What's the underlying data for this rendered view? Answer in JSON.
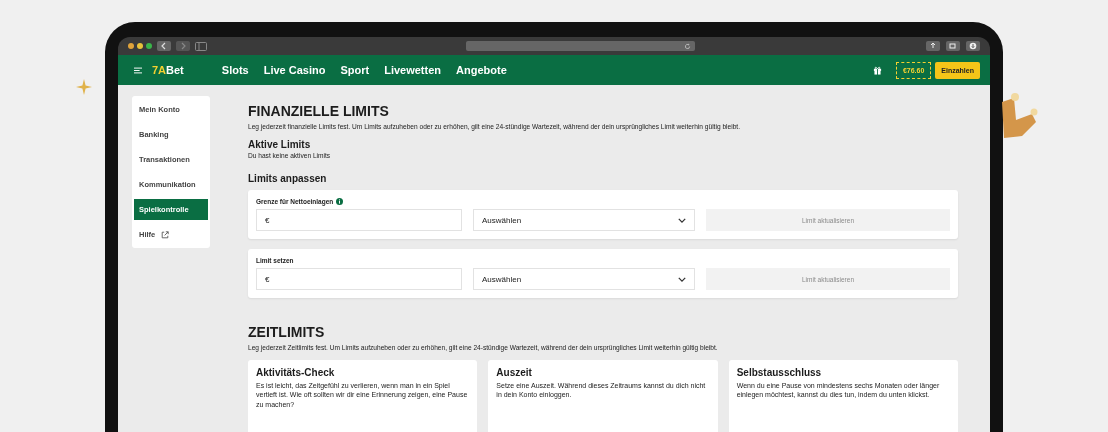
{
  "nav": {
    "logo": {
      "accent": "7A",
      "rest": "Bet"
    },
    "links": [
      "Slots",
      "Live Casino",
      "Sport",
      "Livewetten",
      "Angebote"
    ],
    "balance": "€76.60",
    "deposit": "Einzahlen"
  },
  "sidebar": {
    "items": [
      {
        "label": "Mein Konto",
        "selected": false,
        "kind": "page"
      },
      {
        "label": "Banking",
        "selected": false,
        "kind": "page"
      },
      {
        "label": "Transaktionen",
        "selected": false,
        "kind": "page"
      },
      {
        "label": "Kommunikation",
        "selected": false,
        "kind": "page"
      },
      {
        "label": "Spielkontrolle",
        "selected": true,
        "kind": "page"
      },
      {
        "label": "Hilfe",
        "selected": false,
        "kind": "external"
      }
    ]
  },
  "financial": {
    "title": "FINANZIELLE LIMITS",
    "description": "Leg jederzeit finanzielle Limits fest. Um Limits aufzuheben oder zu erhöhen, gilt eine 24-stündige Wartezeit, während der dein ursprüngliches Limit weiterhin gültig bleibt.",
    "active_title": "Aktive Limits",
    "active_text": "Du hast keine aktiven Limits",
    "adjust_title": "Limits anpassen",
    "cards": [
      {
        "label": "Grenze für Nettoeinlagen",
        "info": true,
        "currency": "€",
        "select": "Auswählen",
        "button": "Limit aktualisieren",
        "disabled": true
      },
      {
        "label": "Limit setzen",
        "info": false,
        "currency": "€",
        "select": "Auswählen",
        "button": "Limit aktualisieren",
        "disabled": true
      }
    ]
  },
  "time": {
    "title": "ZEITLIMITS",
    "description": "Leg jederzeit Zeitlimits fest. Um Limits aufzuheben oder zu erhöhen, gilt eine 24-stündige Wartezeit, während der dein ursprüngliches Limit weiterhin gültig bleibt.",
    "cards": [
      {
        "title": "Aktivitäts-Check",
        "text": "Es ist leicht, das Zeitgefühl zu verlieren, wenn man in ein Spiel vertieft ist. Wie oft sollten wir dir eine Erinnerung zeigen, eine Pause zu machen?"
      },
      {
        "title": "Auszeit",
        "text": "Setze eine Auszeit. Während dieses Zeitraums kannst du dich nicht in dein Konto einloggen."
      },
      {
        "title": "Selbstausschluss",
        "text": "Wenn du eine Pause von mindestens sechs Monaten oder länger einlegen möchtest, kannst du dies tun, indem du unten klickst."
      }
    ]
  }
}
